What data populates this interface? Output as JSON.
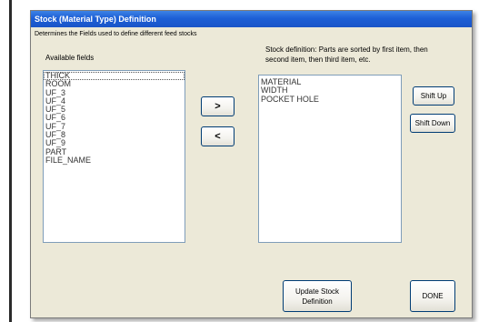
{
  "window": {
    "title": "Stock (Material Type) Definition",
    "description": "Determines the Fields used to define different feed stocks"
  },
  "available": {
    "label": "Available fields",
    "items": [
      "THICK",
      "ROOM",
      "UF_3",
      "UF_4",
      "UF_5",
      "UF_6",
      "UF_7",
      "UF_8",
      "UF_9",
      "PART",
      "FILE_NAME"
    ]
  },
  "definition": {
    "label": "Stock definition: Parts are sorted by first item, then second item, then third item, etc.",
    "items": [
      "MATERIAL",
      "WIDTH",
      "POCKET HOLE"
    ]
  },
  "buttons": {
    "add": ">",
    "remove": "<",
    "shift_up": "Shift Up",
    "shift_down": "Shift Down",
    "update": "Update Stock Definition",
    "done": "DONE"
  }
}
